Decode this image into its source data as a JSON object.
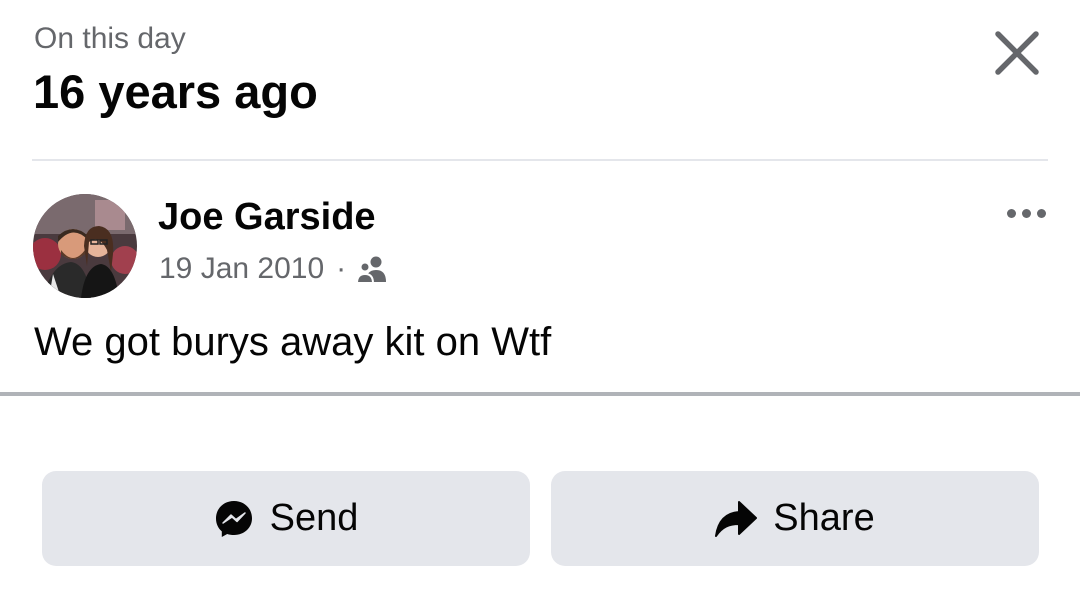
{
  "header": {
    "subtitle": "On this day",
    "title": "16 years ago"
  },
  "post": {
    "author": "Joe Garside",
    "date": "19 Jan 2010",
    "separator": "·",
    "audience_icon": "friends-icon",
    "text": "We got burys away kit on Wtf"
  },
  "actions": {
    "send_label": "Send",
    "share_label": "Share"
  },
  "icons": {
    "close": "close-icon",
    "more": "more-options-icon",
    "send": "messenger-icon",
    "share": "share-arrow-icon"
  },
  "colors": {
    "secondary_text": "#65676b",
    "button_bg": "#e4e6eb",
    "primary_text": "#050505"
  }
}
